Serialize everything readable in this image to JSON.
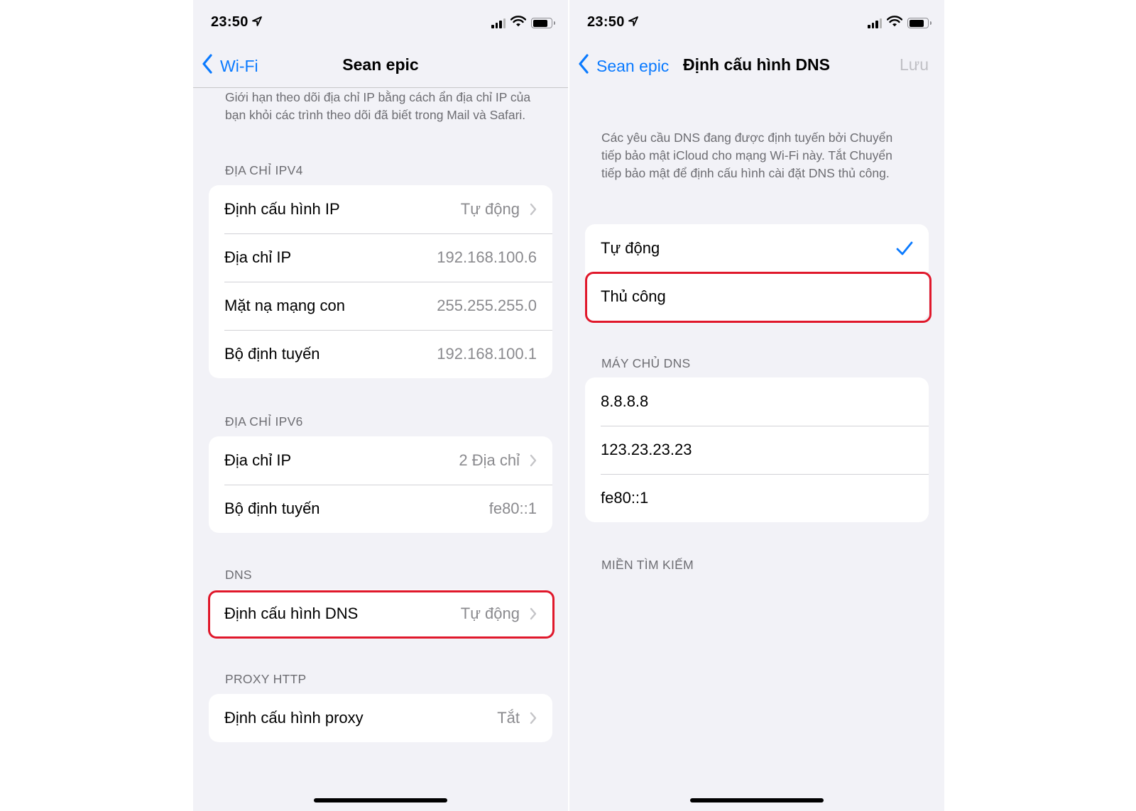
{
  "left": {
    "status": {
      "time": "23:50"
    },
    "nav": {
      "back_label": "Wi-Fi",
      "title": "Sean epic"
    },
    "top_footnote": "Giới hạn theo dõi địa chỉ IP bằng cách ẩn địa chỉ IP của bạn khỏi các trình theo dõi đã biết trong Mail và Safari.",
    "ipv4": {
      "header": "ĐỊA CHỈ IPV4",
      "rows": [
        {
          "label": "Định cấu hình IP",
          "value": "Tự động"
        },
        {
          "label": "Địa chỉ IP",
          "value": "192.168.100.6"
        },
        {
          "label": "Mặt nạ mạng con",
          "value": "255.255.255.0"
        },
        {
          "label": "Bộ định tuyến",
          "value": "192.168.100.1"
        }
      ]
    },
    "ipv6": {
      "header": "ĐỊA CHỈ IPV6",
      "rows": [
        {
          "label": "Địa chỉ IP",
          "value": "2 Địa chỉ"
        },
        {
          "label": "Bộ định tuyến",
          "value": "fe80::1"
        }
      ]
    },
    "dns": {
      "header": "DNS",
      "row": {
        "label": "Định cấu hình DNS",
        "value": "Tự động"
      }
    },
    "proxy": {
      "header": "PROXY HTTP",
      "row": {
        "label": "Định cấu hình proxy",
        "value": "Tắt"
      }
    }
  },
  "right": {
    "status": {
      "time": "23:50"
    },
    "nav": {
      "back_label": "Sean epic",
      "title": "Định cấu hình DNS",
      "save_label": "Lưu"
    },
    "footnote": "Các yêu cầu DNS đang được định tuyến bởi Chuyển tiếp bảo mật iCloud cho mạng Wi-Fi này. Tắt Chuyển tiếp bảo mật để định cấu hình cài đặt DNS thủ công.",
    "options": [
      {
        "label": "Tự động",
        "selected": true
      },
      {
        "label": "Thủ công",
        "selected": false
      }
    ],
    "servers": {
      "header": "MÁY CHỦ DNS",
      "items": [
        "8.8.8.8",
        "123.23.23.23",
        "fe80::1"
      ]
    },
    "search_domains": {
      "header": "MIỀN TÌM KIẾM"
    }
  },
  "colors": {
    "accent": "#0a7aff",
    "highlight": "#e0182b",
    "background": "#f2f2f7",
    "secondary_text": "#8a8a8e"
  },
  "icons": [
    "location-arrow-icon",
    "cellular-signal-icon",
    "wifi-icon",
    "battery-icon",
    "chevron-left-icon",
    "chevron-right-icon",
    "checkmark-icon"
  ]
}
